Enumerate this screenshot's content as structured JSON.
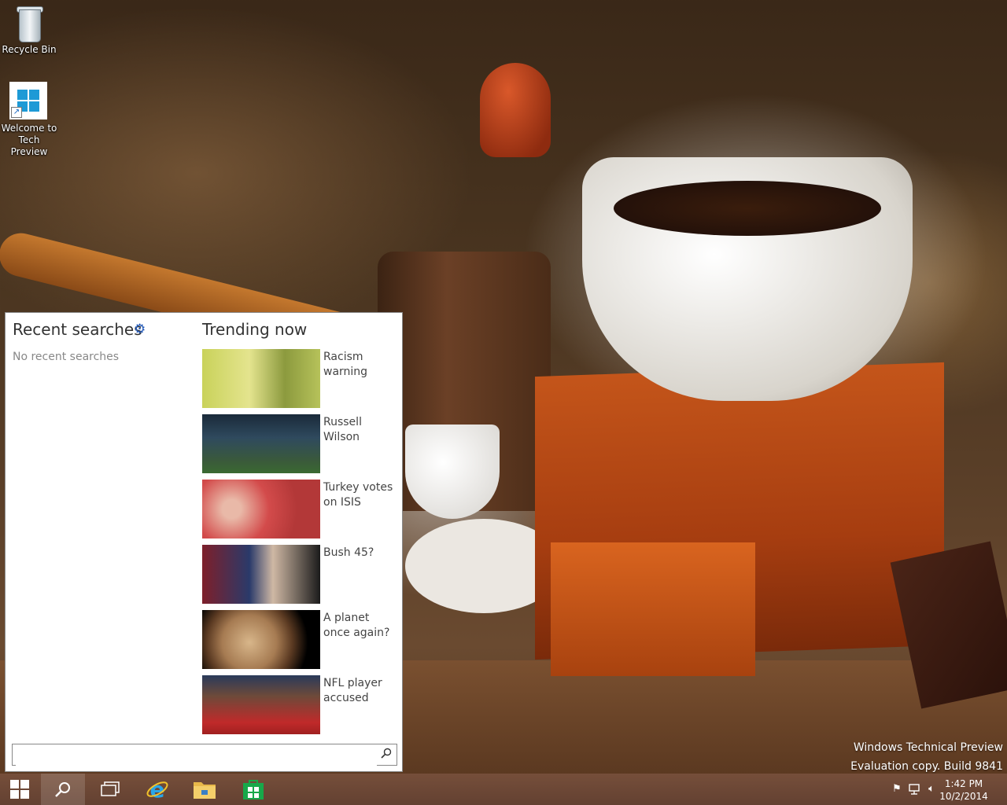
{
  "desktop": {
    "icons": [
      {
        "label": "Recycle Bin"
      },
      {
        "label_line1": "Welcome to",
        "label_line2": "Tech Preview"
      }
    ]
  },
  "search_pane": {
    "recent_title": "Recent searches",
    "no_recent": "No recent searches",
    "trending_title": "Trending now",
    "trending": [
      {
        "label": "Racism warning"
      },
      {
        "label": "Russell Wilson"
      },
      {
        "label": "Turkey votes on ISIS"
      },
      {
        "label": "Bush 45?"
      },
      {
        "label": "A planet once again?"
      },
      {
        "label": "NFL player accused"
      }
    ],
    "search_box": {
      "value": "",
      "placeholder": ""
    }
  },
  "watermark": {
    "line1": "Windows Technical Preview",
    "line2": "Evaluation copy. Build 9841"
  },
  "taskbar": {
    "items": [
      "start-icon",
      "search-icon",
      "task-view-icon",
      "internet-explorer-icon",
      "file-explorer-icon",
      "store-icon"
    ],
    "clock": {
      "time": "1:42 PM",
      "date": "10/2/2014"
    }
  },
  "colors": {
    "accent": "#2359b8",
    "windows_blue": "#1e9ad6",
    "store_green": "#17a84a",
    "taskbar": "#78503c"
  }
}
